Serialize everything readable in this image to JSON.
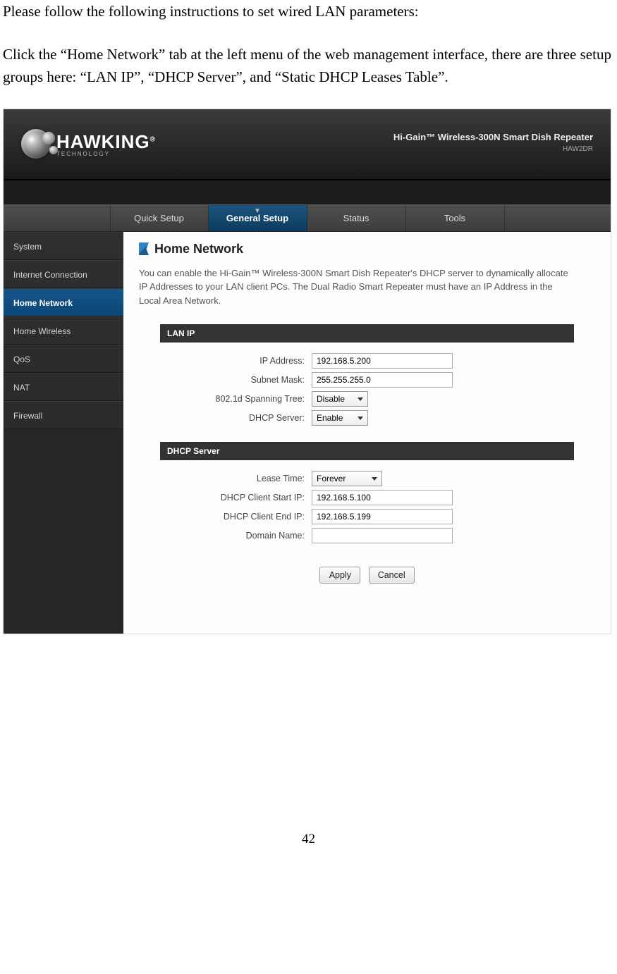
{
  "doc": {
    "para1": "Please follow the following instructions to set wired LAN parameters:",
    "para2": "Click the “Home Network” tab at the left menu of the web management interface, there are three setup groups here: “LAN IP”, “DHCP Server”, and “Static DHCP Leases Table”.",
    "page_number": "42"
  },
  "header": {
    "brand_main": "HAWKING",
    "brand_reg": "®",
    "brand_sub": "TECHNOLOGY",
    "product_name": "Hi-Gain™ Wireless-300N Smart Dish Repeater",
    "model": "HAW2DR"
  },
  "topnav": [
    {
      "label": "Quick Setup",
      "active": false
    },
    {
      "label": "General Setup",
      "active": true
    },
    {
      "label": "Status",
      "active": false
    },
    {
      "label": "Tools",
      "active": false
    }
  ],
  "sidebar": [
    {
      "label": "System",
      "active": false
    },
    {
      "label": "Internet Connection",
      "active": false
    },
    {
      "label": "Home Network",
      "active": true
    },
    {
      "label": "Home Wireless",
      "active": false
    },
    {
      "label": "QoS",
      "active": false
    },
    {
      "label": "NAT",
      "active": false
    },
    {
      "label": "Firewall",
      "active": false
    }
  ],
  "main": {
    "title": "Home Network",
    "description": "You can enable the Hi-Gain™ Wireless-300N Smart Dish Repeater's DHCP server to dynamically allocate IP Addresses to your LAN client PCs. The Dual Radio Smart Repeater must have an IP Address in the Local Area Network.",
    "sections": {
      "lan_ip": {
        "header": "LAN IP",
        "fields": {
          "ip_address_label": "IP Address:",
          "ip_address_value": "192.168.5.200",
          "subnet_mask_label": "Subnet Mask:",
          "subnet_mask_value": "255.255.255.0",
          "spanning_tree_label": "802.1d Spanning Tree:",
          "spanning_tree_value": "Disable",
          "dhcp_server_label": "DHCP Server:",
          "dhcp_server_value": "Enable"
        }
      },
      "dhcp": {
        "header": "DHCP Server",
        "fields": {
          "lease_time_label": "Lease Time:",
          "lease_time_value": "Forever",
          "start_ip_label": "DHCP Client Start IP:",
          "start_ip_value": "192.168.5.100",
          "end_ip_label": "DHCP Client End IP:",
          "end_ip_value": "192.168.5.199",
          "domain_name_label": "Domain Name:",
          "domain_name_value": ""
        }
      }
    },
    "buttons": {
      "apply": "Apply",
      "cancel": "Cancel"
    }
  }
}
